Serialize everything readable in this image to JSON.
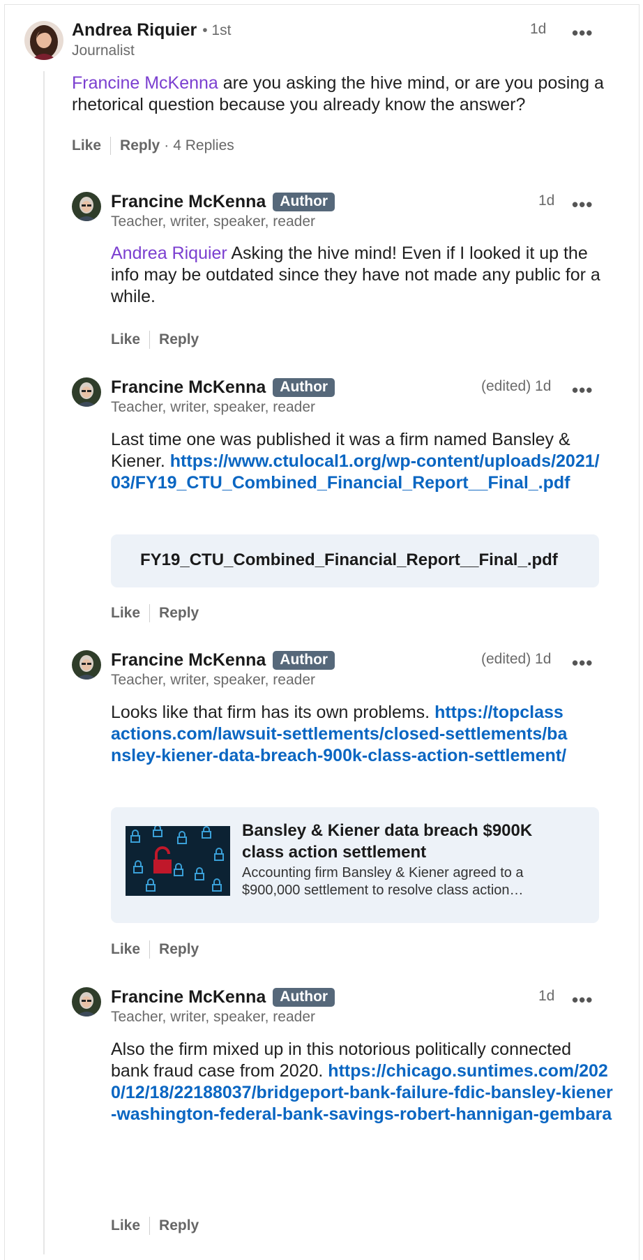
{
  "comments": [
    {
      "name": "Andrea Riquier",
      "degree": "• 1st",
      "headline": "Journalist",
      "time": "1d",
      "mention": "Francine McKenna",
      "text": " are you asking the hive mind, or are you posing a rhetorical question because you already know the answer?",
      "like": "Like",
      "reply": "Reply",
      "replies_count": "4 Replies"
    },
    {
      "name": "Francine McKenna",
      "badge": "Author",
      "headline": "Teacher, writer, speaker, reader",
      "time": "1d",
      "mention": "Andrea Riquier",
      "text": " Asking the hive mind! Even if I looked it up the info may be outdated since they have not made any public for a while.",
      "like": "Like",
      "reply": "Reply"
    },
    {
      "name": "Francine McKenna",
      "badge": "Author",
      "headline": "Teacher, writer, speaker, reader",
      "time": "(edited) 1d",
      "text": "Last time one was published it was a firm named Bansley & Kiener. ",
      "link": "https://www.ctulocal1.org/wp-content/uploads/2021/03/FY19_CTU_Combined_Financial_Report__Final_.pdf",
      "attachment_title": "FY19_CTU_Combined_Financial_Report__Final_.pdf",
      "like": "Like",
      "reply": "Reply"
    },
    {
      "name": "Francine McKenna",
      "badge": "Author",
      "headline": "Teacher, writer, speaker, reader",
      "time": "(edited) 1d",
      "text": "Looks like that firm has its own problems. ",
      "link": "https://topclassactions.com/lawsuit-settlements/closed-settlements/bansley-kiener-data-breach-900k-class-action-settlement/",
      "card_title": "Bansley & Kiener data breach $900K class action settlement",
      "card_desc": "Accounting firm Bansley & Kiener agreed to a $900,000 settlement to resolve class action…",
      "like": "Like",
      "reply": "Reply"
    },
    {
      "name": "Francine McKenna",
      "badge": "Author",
      "headline": "Teacher, writer, speaker, reader",
      "time": "1d",
      "text": "Also the firm mixed up in this notorious politically connected bank fraud case from 2020. ",
      "link": "https://chicago.suntimes.com/2020/12/18/22188037/bridgeport-bank-failure-fdic-bansley-kiener-washington-federal-bank-savings-robert-hannigan-gembara",
      "like": "Like",
      "reply": "Reply"
    }
  ],
  "more_icon": "•••",
  "icons": {
    "more": "ellipsis-icon",
    "lock": "lock-icon"
  },
  "colors": {
    "mention": "#8a3ffc",
    "link": "#0a66c2",
    "badge": "#56687a",
    "attachment_bg": "#edf2f8"
  }
}
